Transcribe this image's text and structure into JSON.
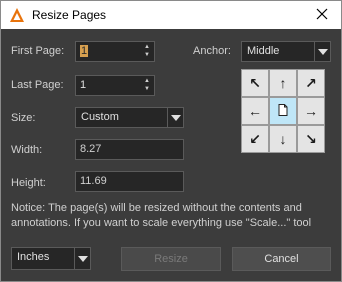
{
  "window": {
    "title": "Resize Pages",
    "icons": {
      "app": "foxit-logo-icon",
      "close": "close-icon"
    }
  },
  "first_page": {
    "label": "First Page:",
    "value": "1"
  },
  "last_page": {
    "label": "Last Page:",
    "value": "1"
  },
  "size": {
    "label": "Size:",
    "value": "Custom"
  },
  "width": {
    "label": "Width:",
    "value": "8.27"
  },
  "height": {
    "label": "Height:",
    "value": "11.69"
  },
  "anchor": {
    "label": "Anchor:",
    "value": "Middle",
    "grid": [
      {
        "name": "top-left",
        "icon": "arrow-up-left-icon",
        "glyph": "↖"
      },
      {
        "name": "top",
        "icon": "arrow-up-icon",
        "glyph": "↑"
      },
      {
        "name": "top-right",
        "icon": "arrow-up-right-icon",
        "glyph": "↗"
      },
      {
        "name": "left",
        "icon": "arrow-left-icon",
        "glyph": "←"
      },
      {
        "name": "middle",
        "icon": "page-icon",
        "glyph": ""
      },
      {
        "name": "right",
        "icon": "arrow-right-icon",
        "glyph": "→"
      },
      {
        "name": "bottom-left",
        "icon": "arrow-down-left-icon",
        "glyph": "↙"
      },
      {
        "name": "bottom",
        "icon": "arrow-down-icon",
        "glyph": "↓"
      },
      {
        "name": "bottom-right",
        "icon": "arrow-down-right-icon",
        "glyph": "↘"
      }
    ],
    "selected": "middle"
  },
  "notice": "Notice: The page(s) will be resized without the contents and annotations. If you want to scale everything use \"Scale...\" tool",
  "units": {
    "value": "Inches"
  },
  "buttons": {
    "resize": "Resize",
    "cancel": "Cancel"
  },
  "colors": {
    "background": "#3c3c3c",
    "field": "#262626",
    "anchor_active": "#bfe6f7",
    "anchor_cell": "#e4e4e4",
    "brand": "#e8730c"
  }
}
